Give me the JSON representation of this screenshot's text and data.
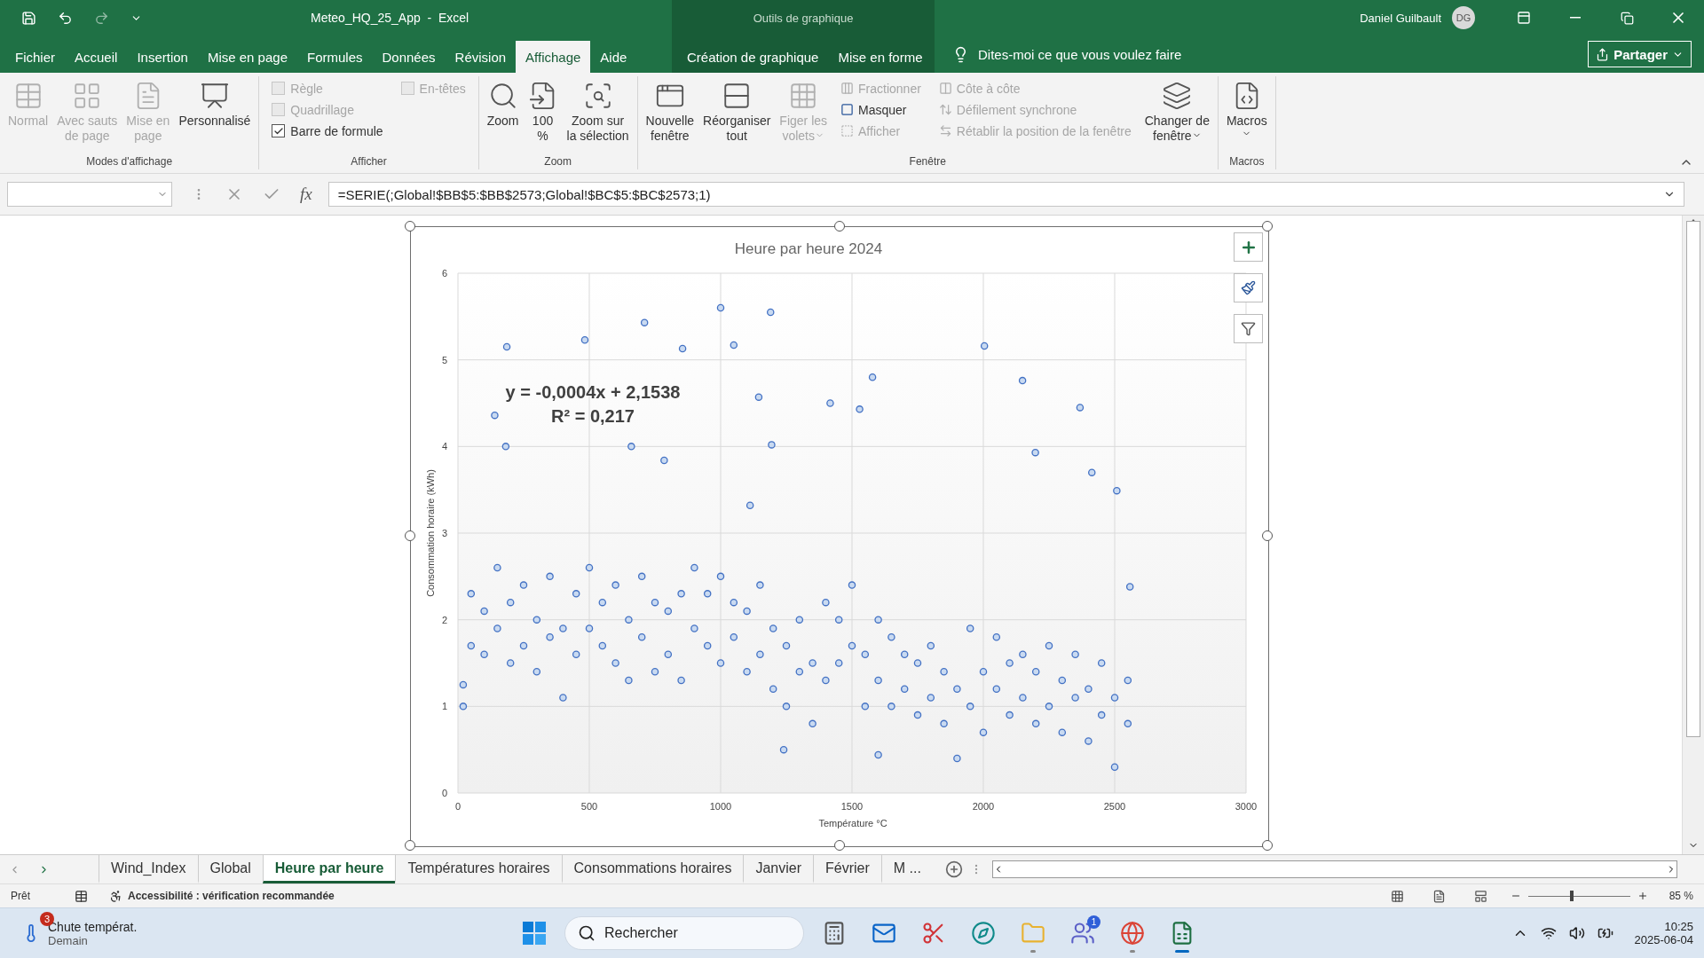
{
  "title_bar": {
    "document": "Meteo_HQ_25_App  -  Excel",
    "context": "Outils de graphique",
    "user": "Daniel Guilbault",
    "initials": "DG"
  },
  "ribbon_tabs": [
    {
      "label": "Fichier",
      "selected": false,
      "kind": "main"
    },
    {
      "label": "Accueil",
      "selected": false,
      "kind": "main"
    },
    {
      "label": "Insertion",
      "selected": false,
      "kind": "main"
    },
    {
      "label": "Mise en page",
      "selected": false,
      "kind": "main"
    },
    {
      "label": "Formules",
      "selected": false,
      "kind": "main"
    },
    {
      "label": "Données",
      "selected": false,
      "kind": "main"
    },
    {
      "label": "Révision",
      "selected": false,
      "kind": "main"
    },
    {
      "label": "Affichage",
      "selected": true,
      "kind": "main"
    },
    {
      "label": "Aide",
      "selected": false,
      "kind": "main"
    },
    {
      "label": "Création de graphique",
      "selected": false,
      "kind": "context"
    },
    {
      "label": "Mise en forme",
      "selected": false,
      "kind": "context"
    }
  ],
  "tell_me": {
    "placeholder": "Dites-moi ce que vous voulez faire"
  },
  "share_button": "Partager",
  "ribbon_groups": [
    {
      "label": "Modes d'affichage",
      "items": [
        {
          "kind": "large",
          "lines": [
            "Normal"
          ],
          "disabled": true
        },
        {
          "kind": "large",
          "lines": [
            "Avec sauts",
            "de page"
          ],
          "disabled": true
        },
        {
          "kind": "large",
          "lines": [
            "Mise en",
            "page"
          ],
          "disabled": true
        },
        {
          "kind": "large",
          "lines": [
            "Personnalisé"
          ],
          "disabled": false
        }
      ]
    },
    {
      "label": "Afficher",
      "items": [
        {
          "kind": "stack",
          "entries": [
            {
              "kind": "check",
              "label": "Règle",
              "checked": false,
              "disabled": true
            },
            {
              "kind": "check",
              "label": "Quadrillage",
              "checked": false,
              "disabled": true
            },
            {
              "kind": "check",
              "label": "Barre de formule",
              "checked": true,
              "disabled": false
            }
          ]
        },
        {
          "kind": "stack",
          "entries": [
            {
              "kind": "check",
              "label": "En-têtes",
              "checked": false,
              "disabled": true
            }
          ]
        }
      ]
    },
    {
      "label": "Zoom",
      "items": [
        {
          "kind": "large",
          "lines": [
            "Zoom"
          ],
          "disabled": false
        },
        {
          "kind": "large",
          "lines": [
            "100",
            "%"
          ],
          "disabled": false
        },
        {
          "kind": "large",
          "lines": [
            "Zoom sur",
            "la sélection"
          ],
          "disabled": false
        }
      ]
    },
    {
      "label": "Fenêtre",
      "items": [
        {
          "kind": "large",
          "lines": [
            "Nouvelle",
            "fenêtre"
          ],
          "disabled": false
        },
        {
          "kind": "large",
          "lines": [
            "Réorganiser",
            "tout"
          ],
          "disabled": false
        },
        {
          "kind": "large",
          "lines": [
            "Figer les",
            "volets"
          ],
          "disabled": true,
          "dropdown": true
        },
        {
          "kind": "stack",
          "entries": [
            {
              "kind": "small",
              "label": "Fractionner",
              "disabled": true
            },
            {
              "kind": "small",
              "label": "Masquer",
              "disabled": false
            },
            {
              "kind": "small",
              "label": "Afficher",
              "disabled": true
            }
          ]
        },
        {
          "kind": "stack",
          "entries": [
            {
              "kind": "small",
              "label": "Côte à côte",
              "disabled": true
            },
            {
              "kind": "small",
              "label": "Défilement synchrone",
              "disabled": true
            },
            {
              "kind": "small",
              "label": "Rétablir la position de la fenêtre",
              "disabled": true
            }
          ]
        },
        {
          "kind": "large",
          "lines": [
            "Changer de",
            "fenêtre"
          ],
          "disabled": false,
          "dropdown": true
        }
      ]
    },
    {
      "label": "Macros",
      "items": [
        {
          "kind": "large",
          "lines": [
            "Macros"
          ],
          "disabled": false,
          "dropdown": true
        }
      ]
    }
  ],
  "formula_bar": {
    "fx": "fx",
    "formula": "=SERIE(;Global!$BB$5:$BB$2573;Global!$BC$5:$BC$2573;1)"
  },
  "chart": {
    "chart_data": {
      "type": "scatter",
      "grid": true,
      "title": "Heure par heure 2024",
      "xlabel": "Température °C",
      "ylabel": "Consommation horaire (kWh)",
      "xlim": [
        0,
        3000
      ],
      "ylim": [
        0,
        6
      ],
      "xticks": [
        0,
        500,
        1000,
        1500,
        2000,
        2500,
        3000
      ],
      "yticks": [
        0,
        1,
        2,
        3,
        4,
        5,
        6
      ],
      "annotations": [
        "y = -0,0004x + 2,1538",
        "R² = 0,217"
      ],
      "x": [
        20,
        20,
        50,
        50,
        100,
        100,
        150,
        150,
        200,
        200,
        250,
        250,
        300,
        300,
        350,
        350,
        400,
        400,
        450,
        450,
        500,
        500,
        550,
        550,
        600,
        600,
        650,
        650,
        700,
        700,
        750,
        750,
        800,
        800,
        850,
        850,
        900,
        900,
        950,
        950,
        1000,
        1000,
        1050,
        1050,
        1100,
        1100,
        1150,
        1150,
        1200,
        1200,
        1250,
        1250,
        1300,
        1300,
        1350,
        1350,
        1400,
        1400,
        1450,
        1450,
        1500,
        1500,
        1550,
        1550,
        1600,
        1600,
        1650,
        1650,
        1700,
        1700,
        1750,
        1750,
        1800,
        1800,
        1850,
        1850,
        1900,
        1900,
        1950,
        1950,
        2000,
        2000,
        2050,
        2050,
        2100,
        2100,
        2150,
        2150,
        2200,
        2200,
        2250,
        2250,
        2300,
        2300,
        2350,
        2350,
        2400,
        2400,
        2450,
        2450,
        2500,
        2500,
        2550,
        2550,
        186,
        483,
        710,
        855,
        1000,
        1050,
        1190,
        2004,
        2149,
        2368,
        1578,
        1145,
        140,
        182,
        660,
        1194,
        2198,
        1417,
        1529,
        2508,
        2413,
        785,
        1112,
        2558,
        1240,
        1600
      ],
      "series": [
        {
          "color": "#4472c4",
          "values": [
            1.0,
            1.25,
            1.7,
            2.3,
            1.6,
            2.1,
            1.9,
            2.6,
            1.5,
            2.2,
            1.7,
            2.4,
            1.4,
            2.0,
            1.8,
            2.5,
            1.1,
            1.9,
            1.6,
            2.3,
            1.9,
            2.6,
            1.7,
            2.2,
            1.5,
            2.4,
            1.3,
            2.0,
            1.8,
            2.5,
            1.4,
            2.2,
            1.6,
            2.1,
            1.3,
            2.3,
            1.9,
            2.6,
            1.7,
            2.3,
            1.5,
            2.5,
            1.8,
            2.2,
            1.4,
            2.1,
            1.6,
            2.4,
            1.2,
            1.9,
            1.0,
            1.7,
            1.4,
            2.0,
            0.8,
            1.5,
            1.3,
            2.2,
            1.5,
            2.0,
            1.7,
            2.4,
            1.0,
            1.6,
            1.3,
            2.0,
            1.0,
            1.8,
            1.2,
            1.6,
            0.9,
            1.5,
            1.1,
            1.7,
            0.8,
            1.4,
            0.4,
            1.2,
            1.0,
            1.9,
            0.7,
            1.4,
            1.2,
            1.8,
            0.9,
            1.5,
            1.1,
            1.6,
            0.8,
            1.4,
            1.0,
            1.7,
            0.7,
            1.3,
            1.1,
            1.6,
            0.6,
            1.2,
            0.9,
            1.5,
            0.3,
            1.1,
            0.8,
            1.3,
            5.15,
            5.23,
            5.43,
            5.13,
            5.6,
            5.17,
            5.55,
            5.16,
            4.76,
            4.45,
            4.8,
            4.57,
            4.36,
            4.0,
            4.0,
            4.02,
            3.93,
            4.5,
            4.43,
            3.49,
            3.7,
            3.84,
            3.32,
            2.38,
            0.5,
            0.44
          ]
        }
      ]
    }
  },
  "sheet_tabs": [
    {
      "label": "Wind_Index",
      "selected": false
    },
    {
      "label": "Global",
      "selected": false
    },
    {
      "label": "Heure par heure",
      "selected": true
    },
    {
      "label": "Températures horaires",
      "selected": false
    },
    {
      "label": "Consommations horaires",
      "selected": false
    },
    {
      "label": "Janvier",
      "selected": false
    },
    {
      "label": "Février",
      "selected": false
    },
    {
      "label": "M ...",
      "selected": false
    }
  ],
  "status_bar": {
    "mode": "Prêt",
    "accessibility": "Accessibilité : vérification recommandée",
    "zoom": {
      "level": 0.43,
      "reading": "85 %"
    }
  },
  "taskbar": {
    "weather": {
      "badge": "3",
      "title": "Chute températ.",
      "subtitle": "Demain"
    },
    "search": {
      "placeholder": "Rechercher"
    },
    "apps": [
      {
        "running": false,
        "active": false
      },
      {
        "running": false,
        "active": false
      },
      {
        "running": false,
        "active": false
      },
      {
        "running": false,
        "active": false
      },
      {
        "running": true,
        "active": false
      },
      {
        "running": false,
        "active": false,
        "badge": "1"
      },
      {
        "running": true,
        "active": false
      },
      {
        "running": true,
        "active": true
      }
    ],
    "time": "10:25",
    "date": "2025-06-04"
  }
}
